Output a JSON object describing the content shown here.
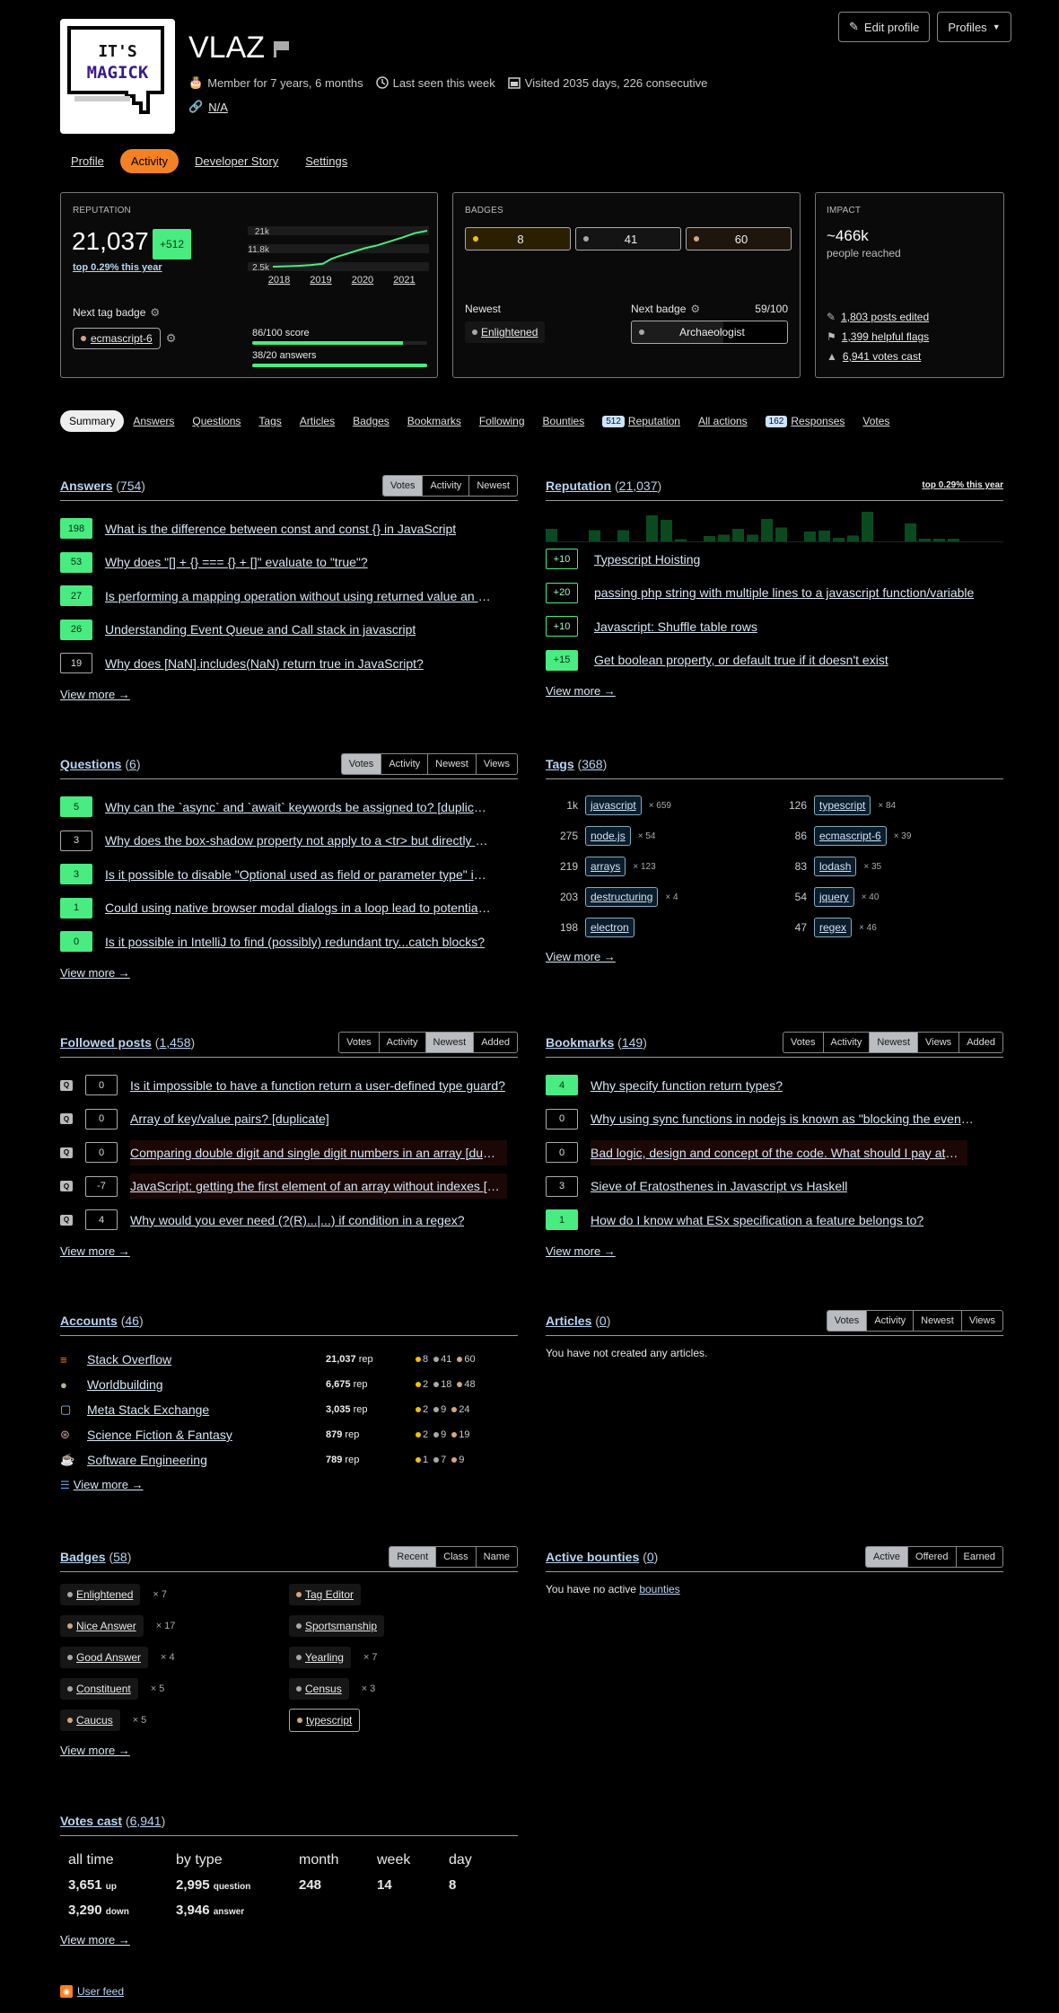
{
  "header": {
    "username": "VLAZ",
    "member_for": "Member for 7 years, 6 months",
    "last_seen": "Last seen this week",
    "visited": "Visited 2035 days, 226 consecutive",
    "website": "N/A",
    "avatar_text_line1": "IT'S",
    "avatar_text_line2": "MAGICK",
    "edit_profile": "Edit profile",
    "profiles": "Profiles"
  },
  "top_nav": [
    {
      "label": "Profile",
      "active": false
    },
    {
      "label": "Activity",
      "active": true
    },
    {
      "label": "Developer Story",
      "active": false
    },
    {
      "label": "Settings",
      "active": false
    }
  ],
  "reputation_box": {
    "heading": "REPUTATION",
    "value": "21,037",
    "change": "+512",
    "rank": "top 0.29% this year",
    "next_tag_badge_label": "Next tag badge",
    "next_tag_badge": "ecmascript-6",
    "score_label": "86/100 score",
    "score_progress": 0.86,
    "answers_label": "38/20 answers",
    "answers_progress": 1.0
  },
  "chart_data": {
    "type": "line",
    "title": "Reputation over time",
    "yticks": [
      "21k",
      "11.8k",
      "2.5k"
    ],
    "xticks": [
      "2018",
      "2019",
      "2020",
      "2021"
    ],
    "x": [
      2017.9,
      2018.2,
      2018.5,
      2018.8,
      2019.1,
      2019.3,
      2019.5,
      2019.8,
      2020.1,
      2020.4,
      2020.7,
      2021.0,
      2021.3,
      2021.6
    ],
    "values": [
      2500,
      2700,
      2900,
      3300,
      4000,
      6500,
      8000,
      10000,
      12000,
      13500,
      15500,
      17500,
      19800,
      21037
    ],
    "ylim": [
      2500,
      21037
    ],
    "color": "#48ec80"
  },
  "badges_box": {
    "heading": "BADGES",
    "gold": "8",
    "silver": "41",
    "bronze": "60",
    "newest_label": "Newest",
    "newest": "Enlightened",
    "next_badge_label": "Next badge",
    "next_badge_progress": "59/100",
    "next_badge_fraction": 0.59,
    "next_badge": "Archaeologist"
  },
  "impact_box": {
    "heading": "IMPACT",
    "reach": "~466k",
    "reach_label": "people reached",
    "posts_edited": "1,803 posts edited",
    "helpful_flags": "1,399 helpful flags",
    "votes_cast": "6,941 votes cast"
  },
  "sub_nav": [
    {
      "label": "Summary",
      "active": true,
      "count": null
    },
    {
      "label": "Answers",
      "count": null
    },
    {
      "label": "Questions",
      "count": null
    },
    {
      "label": "Tags",
      "count": null
    },
    {
      "label": "Articles",
      "count": null
    },
    {
      "label": "Badges",
      "count": null
    },
    {
      "label": "Bookmarks",
      "count": null
    },
    {
      "label": "Following",
      "count": null
    },
    {
      "label": "Bounties",
      "count": null
    },
    {
      "label": "Reputation",
      "count": "512"
    },
    {
      "label": "All actions",
      "count": null
    },
    {
      "label": "Responses",
      "count": "162"
    },
    {
      "label": "Votes",
      "count": null
    }
  ],
  "answers": {
    "title": "Answers",
    "count": "754",
    "sort": [
      "Votes",
      "Activity",
      "Newest"
    ],
    "active_sort": 0,
    "items": [
      {
        "score": "198",
        "accepted": true,
        "title": "What is the difference between const and const {} in JavaScript"
      },
      {
        "score": "53",
        "accepted": true,
        "title": "Why does \"[] + {} === {} + []\" evaluate to \"true\"?"
      },
      {
        "score": "27",
        "accepted": true,
        "title": "Is performing a mapping operation without using returned value an antipattern?"
      },
      {
        "score": "26",
        "accepted": true,
        "title": "Understanding Event Queue and Call stack in javascript"
      },
      {
        "score": "19",
        "accepted": false,
        "title": "Why does [NaN].includes(NaN) return true in JavaScript?"
      }
    ],
    "view_more": "View more →"
  },
  "reputation": {
    "title": "Reputation",
    "count": "21,037",
    "rank": "top 0.29% this year",
    "bars": [
      3,
      0,
      0,
      2.7,
      0,
      2.7,
      0,
      6,
      5,
      0.7,
      0,
      1.4,
      1.7,
      3,
      1.7,
      5.2,
      3.3,
      0,
      2.4,
      2.6,
      1,
      1.5,
      6.8,
      0,
      0,
      4.2,
      0.8,
      0.8,
      0.8
    ],
    "items": [
      {
        "change": "+10",
        "accepted": false,
        "title": "Typescript Hoisting"
      },
      {
        "change": "+20",
        "accepted": false,
        "title": "passing php string with multiple lines to a javascript function/variable"
      },
      {
        "change": "+10",
        "accepted": false,
        "title": "Javascript: Shuffle table rows"
      },
      {
        "change": "+15",
        "accepted": true,
        "title": "Get boolean property, or default true if it doesn't exist"
      }
    ],
    "view_more": "View more →"
  },
  "questions": {
    "title": "Questions",
    "count": "6",
    "sort": [
      "Votes",
      "Activity",
      "Newest",
      "Views"
    ],
    "active_sort": 0,
    "items": [
      {
        "score": "5",
        "accepted": true,
        "title": "Why can the `async` and `await` keywords be assigned to? [duplicate]"
      },
      {
        "score": "3",
        "accepted": false,
        "title": "Why does the box-shadow property not apply to a <tr> but directly to the cells?"
      },
      {
        "score": "3",
        "accepted": true,
        "title": "Is it possible to disable \"Optional used as field or parameter type\" inspection?"
      },
      {
        "score": "1",
        "accepted": true,
        "title": "Could using native browser modal dialogs in a loop lead to potential issues?"
      },
      {
        "score": "0",
        "accepted": true,
        "title": "Is it possible in IntelliJ to find (possibly) redundant try...catch blocks?"
      }
    ],
    "view_more": "View more →"
  },
  "tags": {
    "title": "Tags",
    "count": "368",
    "items": [
      {
        "score": "1k",
        "tag": "javascript",
        "posts": "× 659"
      },
      {
        "score": "126",
        "tag": "typescript",
        "posts": "× 84"
      },
      {
        "score": "275",
        "tag": "node.js",
        "posts": "× 54"
      },
      {
        "score": "86",
        "tag": "ecmascript-6",
        "posts": "× 39"
      },
      {
        "score": "219",
        "tag": "arrays",
        "posts": "× 123"
      },
      {
        "score": "83",
        "tag": "lodash",
        "posts": "× 35"
      },
      {
        "score": "203",
        "tag": "destructuring",
        "posts": "× 4"
      },
      {
        "score": "54",
        "tag": "jquery",
        "posts": "× 40"
      },
      {
        "score": "198",
        "tag": "electron",
        "posts": ""
      },
      {
        "score": "47",
        "tag": "regex",
        "posts": "× 46"
      }
    ],
    "view_more": "View more →"
  },
  "followed": {
    "title": "Followed posts",
    "count": "1,458",
    "sort": [
      "Votes",
      "Activity",
      "Newest",
      "Added"
    ],
    "active_sort": 2,
    "items": [
      {
        "type": "Q",
        "score": "0",
        "closed": false,
        "title": "Is it impossible to have a function return a user-defined type guard?"
      },
      {
        "type": "Q",
        "score": "0",
        "closed": false,
        "title": "Array of key/value pairs? [duplicate]"
      },
      {
        "type": "Q",
        "score": "0",
        "closed": true,
        "title": "Comparing double digit and single digit numbers in an array [duplicate]"
      },
      {
        "type": "Q",
        "score": "-7",
        "closed": true,
        "title": "JavaScript: getting the first element of an array without indexes [closed]"
      },
      {
        "type": "Q",
        "score": "4",
        "closed": false,
        "title": "Why would you ever need (?(R)...|...) if condition in a regex?"
      }
    ],
    "view_more": "View more →"
  },
  "bookmarks": {
    "title": "Bookmarks",
    "count": "149",
    "sort": [
      "Votes",
      "Activity",
      "Newest",
      "Views",
      "Added"
    ],
    "active_sort": 2,
    "items": [
      {
        "score": "4",
        "accepted": true,
        "closed": false,
        "title": "Why specify function return types?"
      },
      {
        "score": "0",
        "accepted": false,
        "closed": false,
        "title": "Why using sync functions in nodejs is known as \"blocking the event loop\"?"
      },
      {
        "score": "0",
        "accepted": false,
        "closed": true,
        "title": "Bad logic, design and concept of the code. What should I pay attention to?"
      },
      {
        "score": "3",
        "accepted": false,
        "closed": false,
        "title": "Sieve of Eratosthenes in Javascript vs Haskell"
      },
      {
        "score": "1",
        "accepted": true,
        "closed": false,
        "title": "How do I know what ESx specification a feature belongs to?"
      }
    ],
    "view_more": "View more →"
  },
  "accounts": {
    "title": "Accounts",
    "count": "46",
    "items": [
      {
        "site": "Stack Overflow",
        "icon": "stackoverflow-icon",
        "rep": "21,037",
        "gold": "8",
        "silver": "41",
        "bronze": "60"
      },
      {
        "site": "Worldbuilding",
        "icon": "worldbuilding-icon",
        "rep": "6,675",
        "gold": "2",
        "silver": "18",
        "bronze": "48"
      },
      {
        "site": "Meta Stack Exchange",
        "icon": "meta-icon",
        "rep": "3,035",
        "gold": "2",
        "silver": "9",
        "bronze": "24"
      },
      {
        "site": "Science Fiction & Fantasy",
        "icon": "scifi-icon",
        "rep": "879",
        "gold": "2",
        "silver": "9",
        "bronze": "19"
      },
      {
        "site": "Software Engineering",
        "icon": "softwareengineering-icon",
        "rep": "789",
        "gold": "1",
        "silver": "7",
        "bronze": "9"
      }
    ],
    "rep_suffix": "rep",
    "view_more": "View more →"
  },
  "articles": {
    "title": "Articles",
    "count": "0",
    "sort": [
      "Votes",
      "Activity",
      "Newest",
      "Views"
    ],
    "active_sort": 0,
    "empty": "You have not created any articles."
  },
  "badges": {
    "title": "Badges",
    "count": "58",
    "sort": [
      "Recent",
      "Class",
      "Name"
    ],
    "active_sort": 0,
    "left": [
      {
        "name": "Enlightened",
        "class": "silver",
        "times": "× 7"
      },
      {
        "name": "Nice Answer",
        "class": "bronze",
        "times": "× 17"
      },
      {
        "name": "Good Answer",
        "class": "silver",
        "times": "× 4"
      },
      {
        "name": "Constituent",
        "class": "silver",
        "times": "× 5"
      },
      {
        "name": "Caucus",
        "class": "bronze",
        "times": "× 5"
      }
    ],
    "right": [
      {
        "name": "Tag Editor",
        "class": "bronze",
        "times": ""
      },
      {
        "name": "Sportsmanship",
        "class": "silver",
        "times": ""
      },
      {
        "name": "Yearling",
        "class": "silver",
        "times": "× 7"
      },
      {
        "name": "Census",
        "class": "silver",
        "times": "× 3"
      },
      {
        "name": "typescript",
        "class": "bronze",
        "times": "",
        "tag": true
      }
    ],
    "view_more": "View more →"
  },
  "bounties": {
    "title": "Active bounties",
    "count": "0",
    "sort": [
      "Active",
      "Offered",
      "Earned"
    ],
    "active_sort": 0,
    "empty_prefix": "You have no active",
    "empty_link": "bounties"
  },
  "votes": {
    "title": "Votes cast",
    "count": "6,941",
    "headers": [
      "all time",
      "by type",
      "month",
      "week",
      "day"
    ],
    "up": "3,651",
    "up_label": "up",
    "down": "3,290",
    "down_label": "down",
    "question": "2,995",
    "question_label": "question",
    "answer": "3,946",
    "answer_label": "answer",
    "month": "248",
    "week": "14",
    "day": "8",
    "view_more": "View more →"
  },
  "user_feed": "User feed"
}
